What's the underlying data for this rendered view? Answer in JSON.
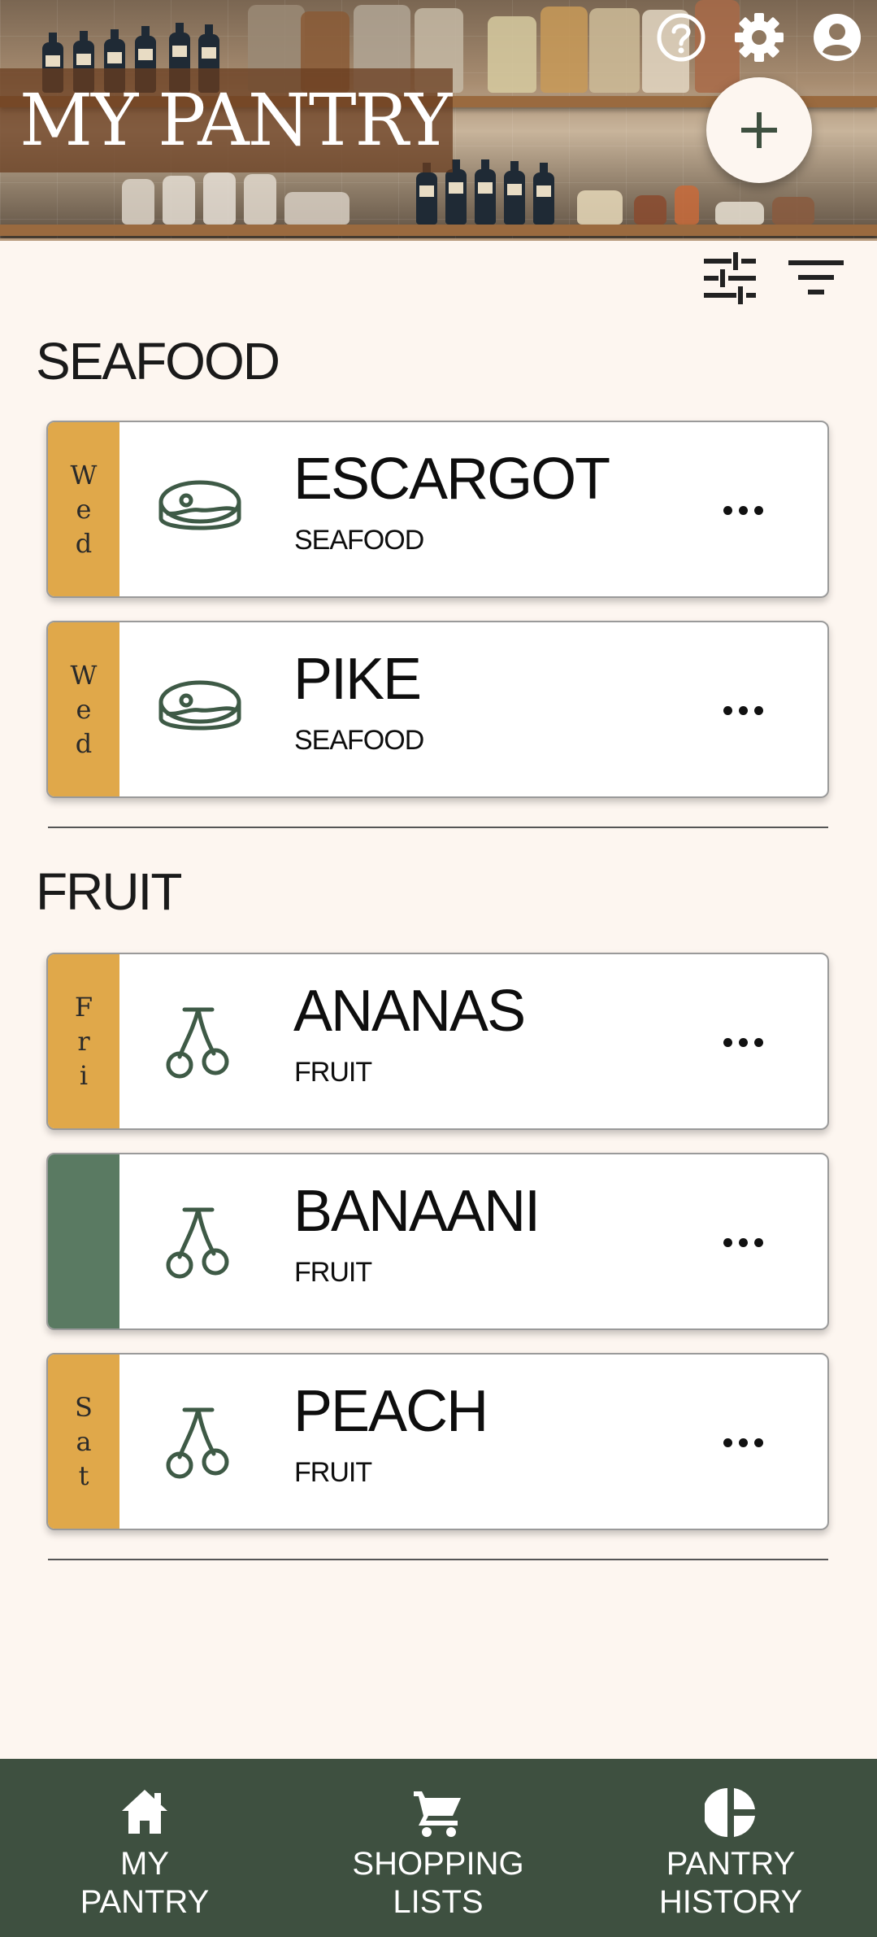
{
  "header": {
    "title": "MY PANTRY",
    "icons": [
      "help-icon",
      "gear-icon",
      "account-icon"
    ],
    "add_icon": "plus-icon"
  },
  "toolbar": {
    "icons": [
      "sliders-icon",
      "filter-icon"
    ]
  },
  "sections": [
    {
      "title": "SEAFOOD",
      "items": [
        {
          "day": [
            "W",
            "e",
            "d"
          ],
          "name": "ESCARGOT",
          "category": "SEAFOOD",
          "icon": "meat-icon",
          "strip_color": "#e0a84a"
        },
        {
          "day": [
            "W",
            "e",
            "d"
          ],
          "name": "PIKE",
          "category": "SEAFOOD",
          "icon": "meat-icon",
          "strip_color": "#e0a84a"
        }
      ]
    },
    {
      "title": "FRUIT",
      "items": [
        {
          "day": [
            "F",
            "r",
            "i"
          ],
          "name": "ANANAS",
          "category": "FRUIT",
          "icon": "cherry-icon",
          "strip_color": "#e0a84a"
        },
        {
          "day": [],
          "name": "BANAANI",
          "category": "FRUIT",
          "icon": "cherry-icon",
          "strip_color": "#5a7a62"
        },
        {
          "day": [
            "S",
            "a",
            "t"
          ],
          "name": "PEACH",
          "category": "FRUIT",
          "icon": "cherry-icon",
          "strip_color": "#e0a84a"
        }
      ]
    }
  ],
  "bottom_nav": [
    {
      "label": "MY\nPANTRY",
      "icon": "home-icon"
    },
    {
      "label": "SHOPPING\nLISTS",
      "icon": "cart-icon"
    },
    {
      "label": "PANTRY\nHISTORY",
      "icon": "pie-chart-icon"
    }
  ],
  "colors": {
    "background": "#fdf6f0",
    "accent_dark_green": "#3e5040",
    "strip_orange": "#e0a84a",
    "strip_green": "#5a7a62",
    "icon_green": "#3e5a46"
  }
}
